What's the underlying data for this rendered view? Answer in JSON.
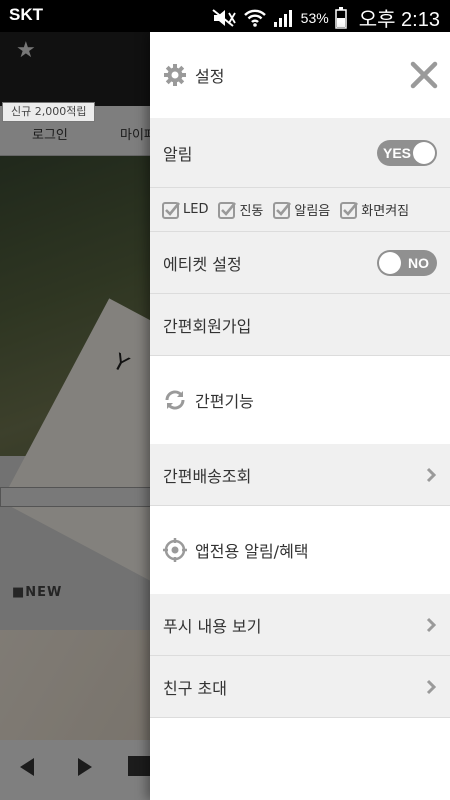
{
  "status_bar": {
    "carrier": "SKT",
    "battery_percent": "53%",
    "time": "오후 2:13"
  },
  "background": {
    "badge": "신규 2,000적립",
    "nav_items": [
      "로그인",
      "마이페"
    ],
    "section_new": "■NEW",
    "card_text": "Y E"
  },
  "drawer": {
    "title": "설정",
    "notifications": {
      "label": "알림",
      "toggle": "YES"
    },
    "checkboxes": [
      "LED",
      "진동",
      "알림음",
      "화면켜짐"
    ],
    "etiquette": {
      "label": "에티켓 설정",
      "toggle": "NO"
    },
    "easy_signup": "간편회원가입",
    "easy_features": "간편기능",
    "easy_delivery": "간편배송조회",
    "app_alerts": "앱전용 알림/혜택",
    "push_view": "푸시 내용 보기",
    "invite": "친구 초대"
  },
  "colors": {
    "toggle_gray": "#909090",
    "section_gray": "#f0f0f0",
    "icon_gray": "#9a9a9a"
  }
}
